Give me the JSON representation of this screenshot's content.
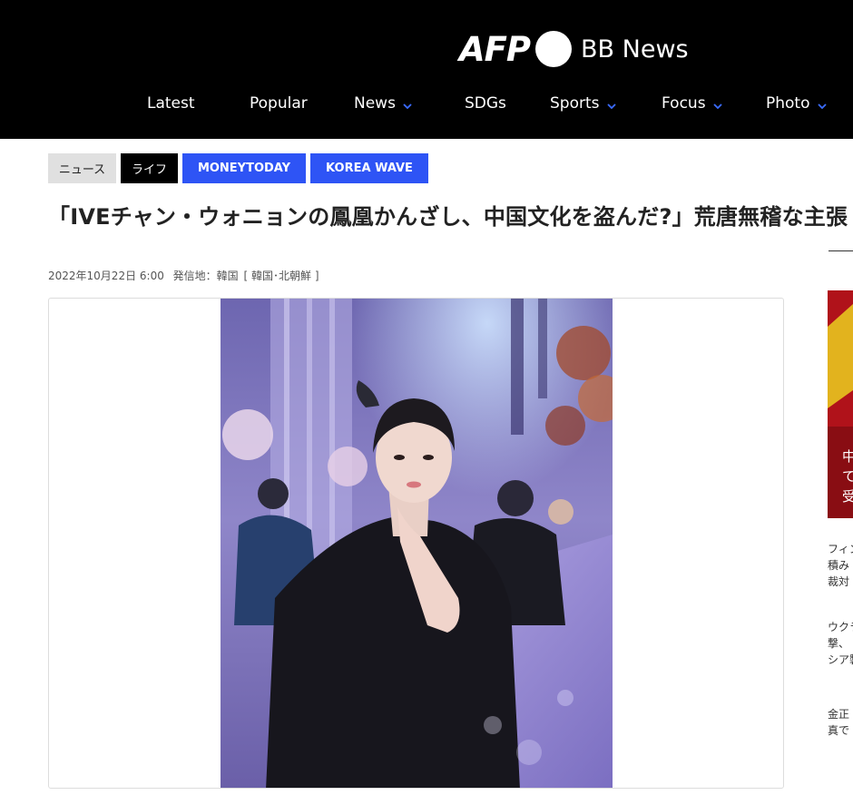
{
  "header": {
    "logo_afp": "AFP",
    "logo_bbnews": "BB News",
    "nav": [
      {
        "label": "Latest",
        "dropdown": false
      },
      {
        "label": "Popular",
        "dropdown": false
      },
      {
        "label": "News",
        "dropdown": true
      },
      {
        "label": "SDGs",
        "dropdown": false
      },
      {
        "label": "Sports",
        "dropdown": true
      },
      {
        "label": "Focus",
        "dropdown": true
      },
      {
        "label": "Photo",
        "dropdown": true
      }
    ]
  },
  "article": {
    "tags": [
      "ニュース",
      "ライフ",
      "MONEYTODAY",
      "KOREA WAVE"
    ],
    "title": "「IVEチャン・ウォニョンの鳳凰かんざし、中国文化を盗んだ?」荒唐無稽な主張",
    "date": "2022年10月22日 6:00",
    "location_label": "発信地：韓国",
    "region": "[ 韓国･北朝鮮 ]"
  },
  "sidebar": {
    "photo_caption_lines": [
      "中",
      "て",
      "受"
    ],
    "items": [
      [
        "フィン",
        "積み",
        "裁対"
      ],
      [
        "ウクラ",
        "撃、",
        "シア製"
      ],
      [
        "金正",
        "真で"
      ]
    ]
  },
  "colors": {
    "header_bg": "#000000",
    "accent_blue": "#2e54f5",
    "chevron": "#3b6cff"
  }
}
